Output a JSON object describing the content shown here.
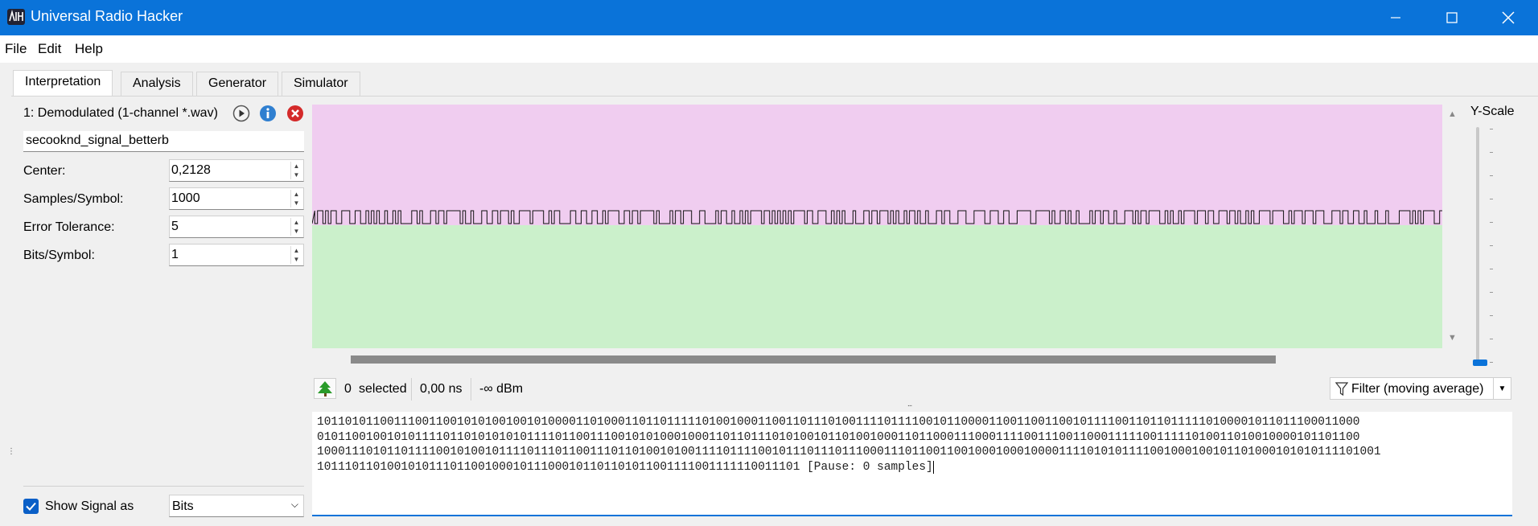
{
  "window": {
    "title": "Universal Radio Hacker",
    "accent": "#0a73d9"
  },
  "menu": {
    "file": "File",
    "edit": "Edit",
    "help": "Help"
  },
  "tabs": [
    {
      "label": "Interpretation",
      "active": true
    },
    {
      "label": "Analysis"
    },
    {
      "label": "Generator"
    },
    {
      "label": "Simulator"
    }
  ],
  "signal": {
    "header": "1:  Demodulated (1-channel *.wav)",
    "name": "secooknd_signal_betterb",
    "params": [
      {
        "label": "Center:",
        "value": "0,2128"
      },
      {
        "label": "Samples/Symbol:",
        "value": "1000"
      },
      {
        "label": "Error Tolerance:",
        "value": "5"
      },
      {
        "label": "Bits/Symbol:",
        "value": "1"
      }
    ],
    "show_signal_label": "Show Signal as",
    "show_signal_checked": true,
    "show_signal_as": "Bits"
  },
  "yscale": {
    "label": "Y-Scale"
  },
  "status": {
    "selected_count": "0",
    "selected_label": "selected",
    "time": "0,00 ns",
    "power": "-∞ dBm",
    "filter_label": "Filter (moving average)"
  },
  "colors": {
    "noise_region": "#f0cdf0",
    "signal_region": "#cbf0cb"
  },
  "bits": {
    "lines": [
      "10110101100111001100101010010010100001101000110110111110100100011001101110100111101111001011000011001100110010111100110110111110100001011011100011000",
      "01011001001010111101101010101011110110011100101010001000110110111010100101101001000110110001110001111001110011000111110011111010011010010000101101100",
      "10001110101101111001010010111101110110011101101001010011110111100101110111011100011101100110010001000100001111010101111001000100101101000101010111101001",
      "101110110100101011101100100010111000101101101011001111001111110011101 "
    ],
    "pause_text": "[Pause: 0 samples]"
  }
}
